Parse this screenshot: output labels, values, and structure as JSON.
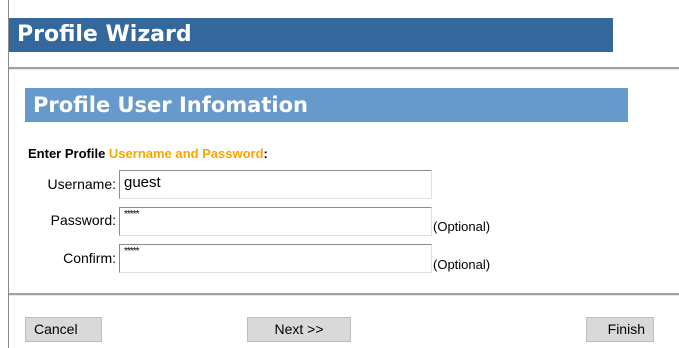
{
  "wizard": {
    "title": "Profile Wizard"
  },
  "section": {
    "title": "Profile User Infomation"
  },
  "prompt": {
    "prefix": "Enter Profile ",
    "highlight": "Username and Password",
    "suffix": ":"
  },
  "fields": {
    "username": {
      "label": "Username:",
      "value": "guest"
    },
    "password": {
      "label": "Password:",
      "value": "*****",
      "note": "(Optional)"
    },
    "confirm": {
      "label": "Confirm:",
      "value": "*****",
      "note": "(Optional)"
    }
  },
  "buttons": {
    "cancel": "Cancel",
    "next": "Next >>",
    "finish": "Finish"
  },
  "colors": {
    "title_bar": "#34689c",
    "section_bar": "#6699cc",
    "accent": "#f7a600"
  }
}
